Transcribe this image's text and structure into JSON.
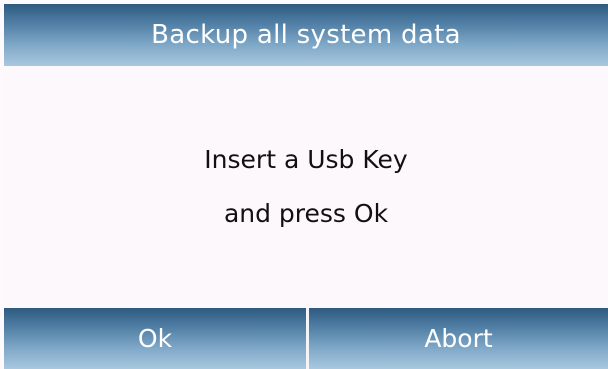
{
  "dialog": {
    "title": "Backup all system data",
    "message_lines": [
      "Insert a Usb Key",
      "and press Ok"
    ]
  },
  "buttons": {
    "ok_label": "Ok",
    "abort_label": "Abort"
  },
  "colors": {
    "header_gradient_top": "#2e5a80",
    "header_gradient_bottom": "#a9c8df",
    "background": "#fcf8fc",
    "text": "#111111"
  }
}
